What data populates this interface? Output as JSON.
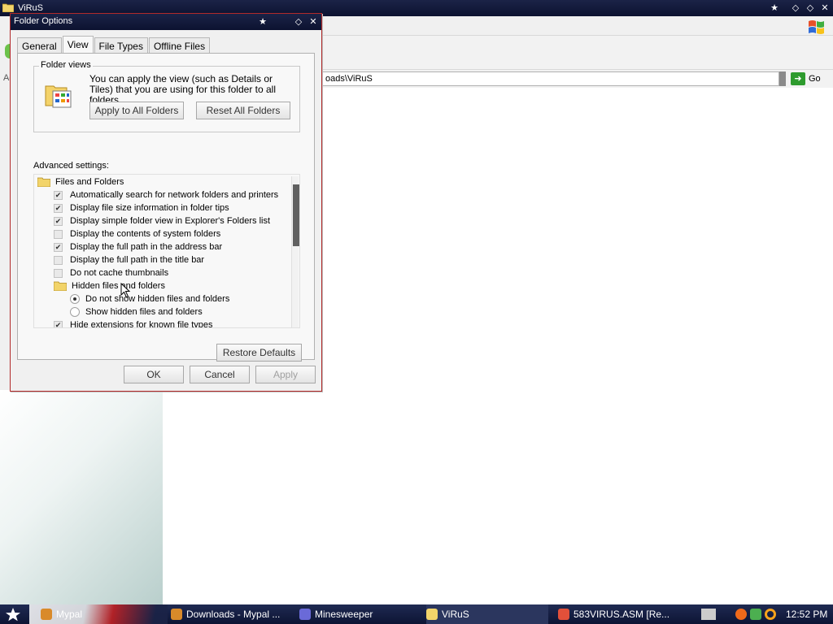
{
  "background_window": {
    "title": "ViRuS",
    "address_value": "oads\\ViRuS",
    "left_fragment": "Ad",
    "go_label": "Go"
  },
  "dialog": {
    "title": "Folder Options",
    "tabs": [
      {
        "label": "General",
        "active": false
      },
      {
        "label": "View",
        "active": true
      },
      {
        "label": "File Types",
        "active": false
      },
      {
        "label": "Offline Files",
        "active": false
      }
    ],
    "folder_views": {
      "label": "Folder views",
      "description": "You can apply the view (such as Details or Tiles) that you are using for this folder to all folders.",
      "apply_all_label": "Apply to All Folders",
      "reset_all_label": "Reset All Folders"
    },
    "advanced_label": "Advanced settings:",
    "advanced_items": [
      {
        "type": "folder",
        "label": "Files and Folders",
        "indent": 0
      },
      {
        "type": "check",
        "label": "Automatically search for network folders and printers",
        "checked": true,
        "indent": 1
      },
      {
        "type": "check",
        "label": "Display file size information in folder tips",
        "checked": true,
        "indent": 1
      },
      {
        "type": "check",
        "label": "Display simple folder view in Explorer's Folders list",
        "checked": true,
        "indent": 1
      },
      {
        "type": "check",
        "label": "Display the contents of system folders",
        "checked": false,
        "indent": 1
      },
      {
        "type": "check",
        "label": "Display the full path in the address bar",
        "checked": true,
        "indent": 1
      },
      {
        "type": "check",
        "label": "Display the full path in the title bar",
        "checked": false,
        "indent": 1
      },
      {
        "type": "check",
        "label": "Do not cache thumbnails",
        "checked": false,
        "indent": 1
      },
      {
        "type": "folder",
        "label": "Hidden files and folders",
        "indent": 1
      },
      {
        "type": "radio",
        "label": "Do not show hidden files and folders",
        "checked": true,
        "indent": 2
      },
      {
        "type": "radio",
        "label": "Show hidden files and folders",
        "checked": false,
        "indent": 2
      },
      {
        "type": "check",
        "label": "Hide extensions for known file types",
        "checked": true,
        "indent": 1
      }
    ],
    "restore_defaults_label": "Restore Defaults",
    "ok_label": "OK",
    "cancel_label": "Cancel",
    "apply_label": "Apply"
  },
  "taskbar": {
    "items": [
      {
        "label": "Mypal",
        "active": false,
        "icon": "mypal-icon"
      },
      {
        "label": "Downloads - Mypal ...",
        "active": false,
        "icon": "mypal-icon"
      },
      {
        "label": "Minesweeper",
        "active": false,
        "icon": "minesweeper-icon"
      },
      {
        "label": "ViRuS",
        "active": true,
        "icon": "folder-icon"
      },
      {
        "label": "583VIRUS.ASM [Re...",
        "active": false,
        "icon": "editor-icon"
      }
    ],
    "clock": "12:52 PM"
  }
}
